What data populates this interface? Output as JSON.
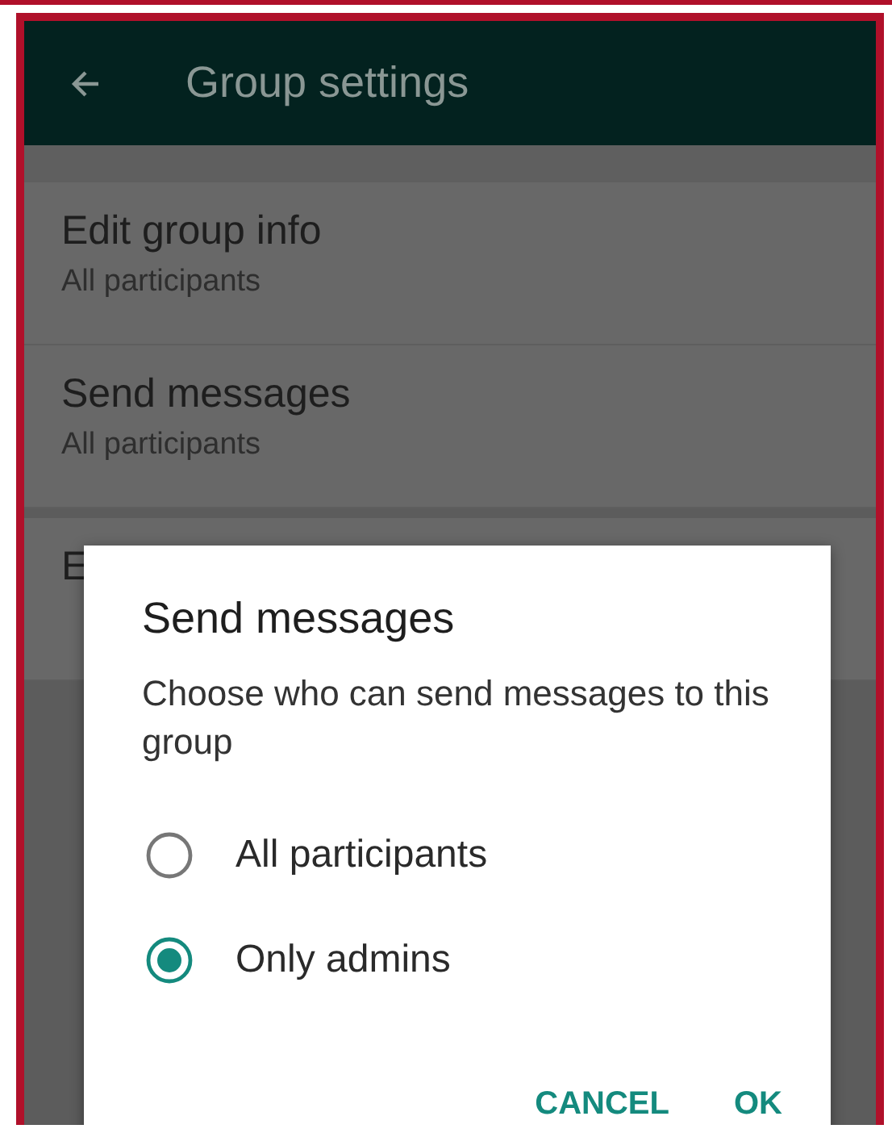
{
  "header": {
    "title": "Group settings"
  },
  "settings": [
    {
      "title": "Edit group info",
      "subtitle": "All participants"
    },
    {
      "title": "Send messages",
      "subtitle": "All participants"
    },
    {
      "title": "E"
    }
  ],
  "dialog": {
    "title": "Send messages",
    "message": "Choose who can send messages to this group",
    "options": [
      {
        "label": "All participants",
        "selected": false
      },
      {
        "label": "Only admins",
        "selected": true
      }
    ],
    "buttons": [
      "CANCEL",
      "OK"
    ]
  }
}
